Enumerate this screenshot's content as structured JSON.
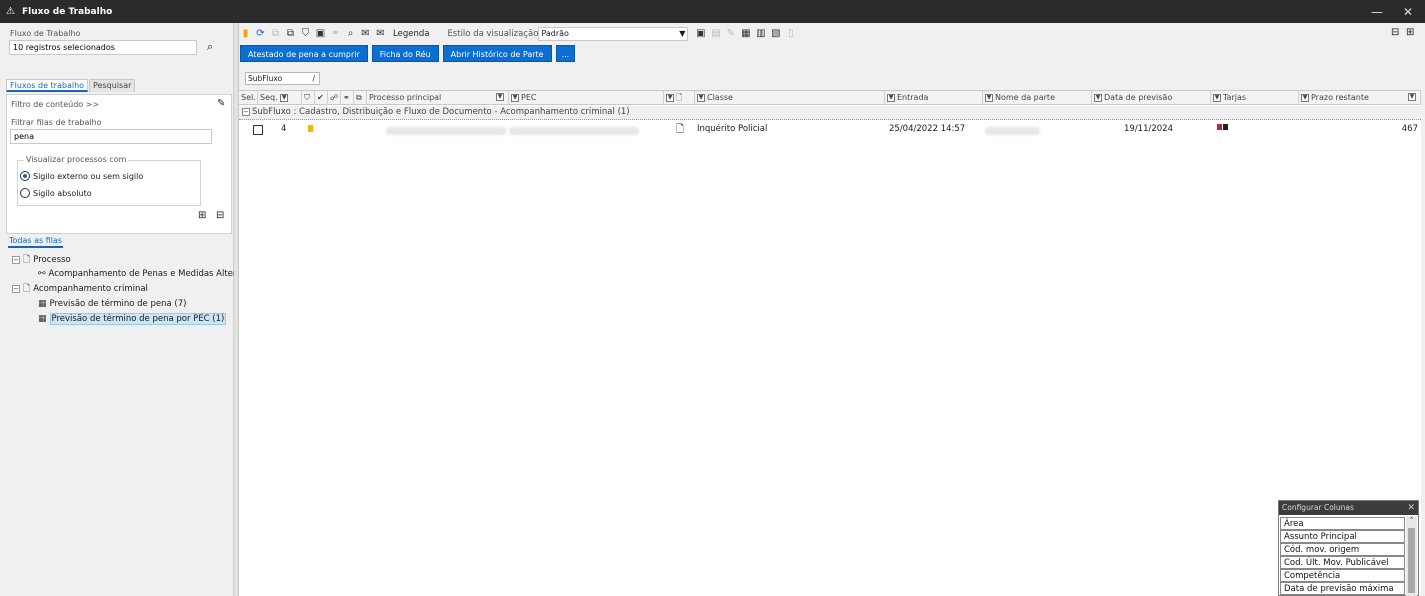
{
  "window": {
    "title": "Fluxo de Trabalho"
  },
  "left": {
    "fluxo_label": "Fluxo de Trabalho",
    "fluxo_value": "10 registros selecionados",
    "tabs": [
      "Fluxos de trabalho",
      "Pesquisar"
    ],
    "filtro_conteudo": "Filtro de conteúdo >>",
    "filtrar_label": "Filtrar filas de trabalho",
    "filtrar_value": "pena",
    "visualizar_legend": "Visualizar processos com",
    "radio1": "Sigilo externo ou sem sigilo",
    "radio2": "Sigilo absoluto",
    "tree_tab": "Todas as filas",
    "tree": [
      "Processo",
      "Acompanhamento  de Penas e Medidas Alter",
      "Acompanhamento criminal",
      "Previsão de término de pena (7)",
      "Previsão de término de pena por PEC (1)"
    ]
  },
  "toolbar": {
    "legenda": "Legenda",
    "estilo_label": "Estilo da visualização",
    "estilo_value": "Padrão"
  },
  "buttons": [
    "Atestado de pena a cumprir",
    "Ficha do Réu",
    "Abrir Histórico de Parte",
    "..."
  ],
  "group_chip": "SubFluxo",
  "grid": {
    "headers": {
      "sel": "Sel.",
      "seq": "Seq.",
      "processo": "Processo principal",
      "pec": "PEC",
      "classe": "Classe",
      "entrada": "Entrada",
      "nome": "Nome da parte",
      "previsao": "Data de previsão",
      "tarjas": "Tarjas",
      "prazo": "Prazo restante"
    },
    "group_row": "SubFluxo : Cadastro, Distribuição e Fluxo de Documento - Acompanhamento criminal  (1)",
    "row": {
      "seq": "4",
      "classe": "Inquérito Policial",
      "entrada": "25/04/2022 14:57",
      "previsao": "19/11/2024",
      "prazo": "467",
      "tarja_colors": [
        "#c0272d",
        "#222222"
      ]
    }
  },
  "config_columns": {
    "title": "Configurar Colunas",
    "items": [
      "Área",
      "Assunto Principal",
      "Cód. mov. origem",
      "Cod. Últ. Mov. Publicável",
      "Competência",
      "Data de previsão máxima"
    ]
  }
}
